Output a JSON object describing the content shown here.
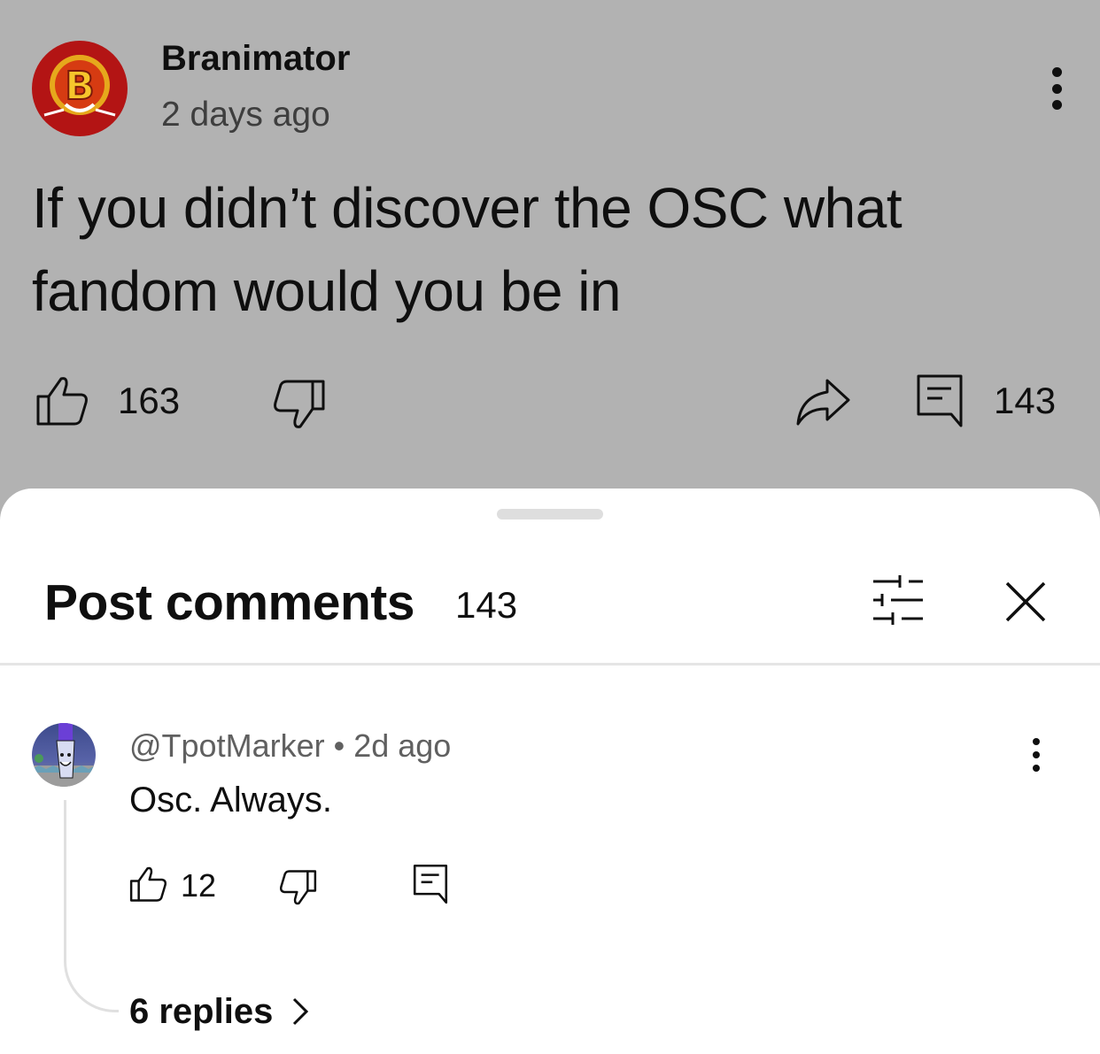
{
  "post": {
    "author": "Branimator",
    "time": "2 days ago",
    "text": "If you didn’t discover the OSC what fandom would you be in",
    "likes": "163",
    "comments": "143",
    "avatar_letter": "B"
  },
  "sheet": {
    "title": "Post comments",
    "count": "143"
  },
  "comments": [
    {
      "author": "@TpotMarker",
      "time": "2d ago",
      "meta": "@TpotMarker • 2d ago",
      "text": "Osc. Always.",
      "likes": "12",
      "replies_label": "6 replies"
    }
  ],
  "icons": {
    "like": "thumbs-up-icon",
    "dislike": "thumbs-down-icon",
    "share": "share-icon",
    "comment": "comment-icon",
    "filter": "sliders-icon",
    "close": "close-icon",
    "more": "more-vertical-icon",
    "chevron": "chevron-right-icon"
  },
  "colors": {
    "dim_background": "#b2b2b2",
    "text_primary": "#0f0f0f",
    "text_secondary": "#606060",
    "avatar_red": "#b31414",
    "avatar_gold": "#e8b21a"
  }
}
